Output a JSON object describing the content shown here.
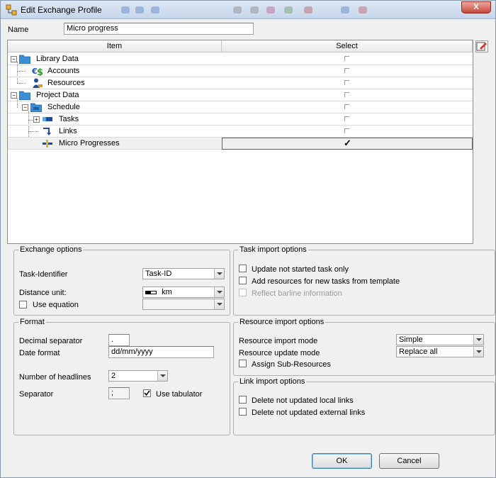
{
  "window": {
    "title": "Edit Exchange Profile",
    "close_label": "X"
  },
  "name_field": {
    "label": "Name",
    "value": "Micro progress"
  },
  "tree": {
    "col_item": "Item",
    "col_select": "Select",
    "rows": [
      {
        "label": "Library Data",
        "checked": false
      },
      {
        "label": "Accounts",
        "checked": false
      },
      {
        "label": "Resources",
        "checked": false
      },
      {
        "label": "Project Data",
        "checked": false
      },
      {
        "label": "Schedule",
        "checked": false
      },
      {
        "label": "Tasks",
        "checked": false
      },
      {
        "label": "Links",
        "checked": false
      },
      {
        "label": "Micro Progresses",
        "checked": true
      }
    ],
    "check_mark": "✓"
  },
  "exchange_options": {
    "title": "Exchange options",
    "task_identifier_label": "Task-Identifier",
    "task_identifier_value": "Task-ID",
    "distance_unit_label": "Distance unit:",
    "distance_unit_value": "km",
    "use_equation_label": "Use equation"
  },
  "format": {
    "title": "Format",
    "decimal_separator_label": "Decimal separator",
    "decimal_separator_value": ".",
    "date_format_label": "Date format",
    "date_format_value": "dd/mm/yyyy",
    "headlines_label": "Number of headlines",
    "headlines_value": "2",
    "separator_label": "Separator",
    "separator_value": ";",
    "use_tabulator_label": "Use tabulator"
  },
  "task_import": {
    "title": "Task import options",
    "update_not_started": "Update not started task only",
    "add_resources": "Add resources for new tasks from template",
    "reflect_barline": "Reflect barline information"
  },
  "resource_import": {
    "title": "Resource import options",
    "import_mode_label": "Resource import mode",
    "import_mode_value": "Simple",
    "update_mode_label": "Resource update mode",
    "update_mode_value": "Replace all",
    "assign_sub": "Assign Sub-Resources"
  },
  "link_import": {
    "title": "Link import options",
    "delete_local": "Delete not updated local links",
    "delete_external": "Delete not updated external links"
  },
  "buttons": {
    "ok": "OK",
    "cancel": "Cancel"
  },
  "colors": {
    "title_bg": "#c6d6ea",
    "close_red": "#c8463a",
    "folder_blue": "#3a8ed6"
  }
}
